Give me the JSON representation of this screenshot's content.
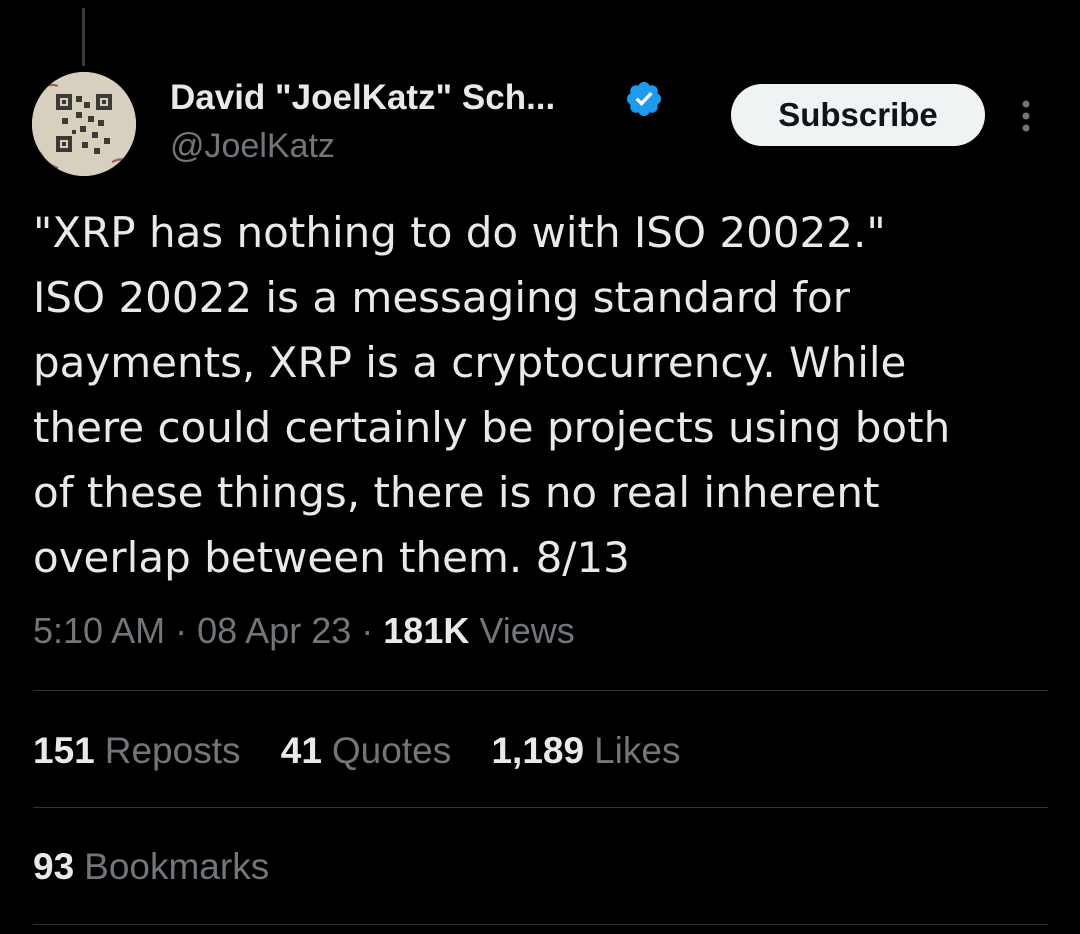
{
  "author": {
    "display_name": "David \"JoelKatz\" Sch...",
    "handle": "@JoelKatz"
  },
  "verified_icon": "verified-badge-icon",
  "subscribe_label": "Subscribe",
  "more_icon": "more-vertical-icon",
  "tweet": {
    "lines": [
      "\"XRP has nothing to do with ISO 20022.\"",
      "ISO 20022 is a messaging standard for",
      "payments, XRP is a cryptocurrency. While",
      "there could certainly be projects using both",
      "of these things, there is no real inherent",
      "overlap between them. 8/13"
    ]
  },
  "meta": {
    "time": "5:10 AM",
    "sep1": "·",
    "date": "08 Apr 23",
    "sep2": "·",
    "views_count": "181K",
    "views_label": "Views"
  },
  "stats": {
    "reposts_count": "151",
    "reposts_label": "Reposts",
    "quotes_count": "41",
    "quotes_label": "Quotes",
    "likes_count": "1,189",
    "likes_label": "Likes",
    "bookmarks_count": "93",
    "bookmarks_label": "Bookmarks"
  },
  "colors": {
    "background": "#000000",
    "primary_text": "#e7e9ea",
    "secondary_text": "#71767b",
    "verified_blue": "#1d9bf0",
    "divider": "#2f3336"
  }
}
